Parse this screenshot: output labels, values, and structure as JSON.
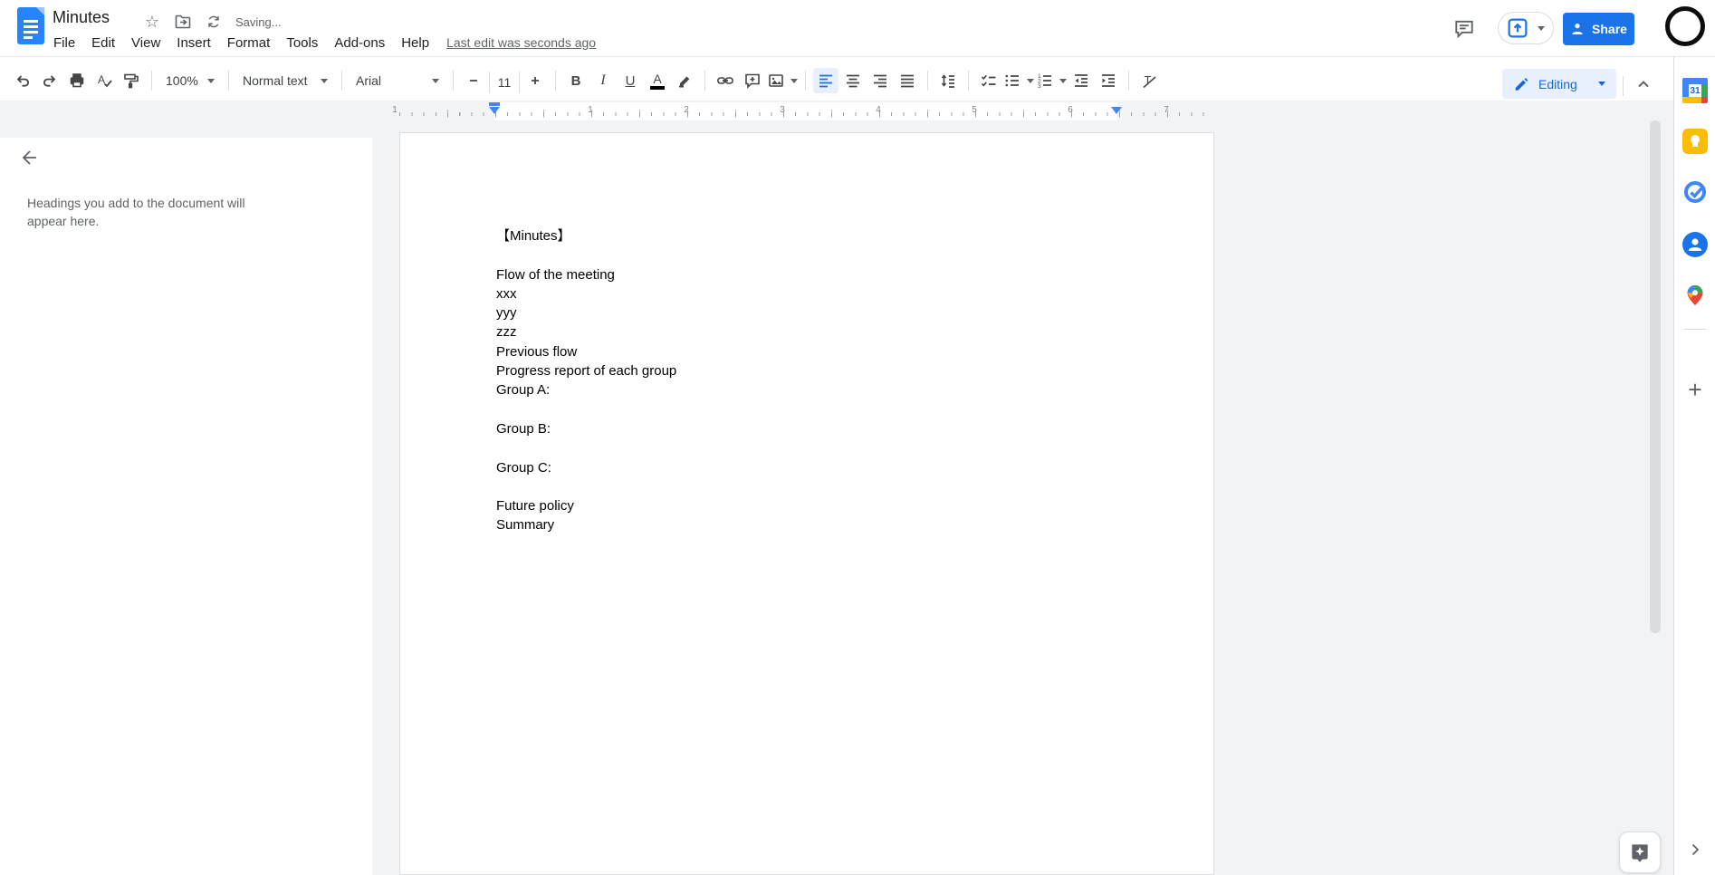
{
  "header": {
    "title": "Minutes",
    "status": "Saving...",
    "menu_items": [
      "File",
      "Edit",
      "View",
      "Insert",
      "Format",
      "Tools",
      "Add-ons",
      "Help"
    ],
    "last_edit": "Last edit was seconds ago",
    "share_label": "Share"
  },
  "toolbar": {
    "zoom_value": "100%",
    "paragraph_style": "Normal text",
    "font_family": "Arial",
    "font_size": "11",
    "bold_label": "B",
    "italic_label": "I",
    "underline_label": "U",
    "text_color_label": "A",
    "mode_label": "Editing"
  },
  "ruler": {
    "margin_label": "1",
    "inch_labels": [
      "1",
      "2",
      "3",
      "4",
      "5",
      "6",
      "7"
    ]
  },
  "outline_panel": {
    "placeholder": "Headings you add to the document will appear here."
  },
  "document": {
    "lines": [
      "【Minutes】",
      "",
      "Flow of the meeting",
      "xxx",
      "yyy",
      "zzz",
      "Previous flow",
      "Progress report of each group",
      "Group A:",
      "",
      "Group B:",
      "",
      "Group C:",
      "",
      "Future policy",
      "Summary"
    ]
  },
  "side_panel": {
    "calendar_label": "31",
    "add_label": "+"
  },
  "colors": {
    "accent_blue": "#1a73e8",
    "docs_logo_blue": "#2684fc",
    "editing_pill_bg": "#e8f0fe",
    "editing_pill_text": "#1967d2",
    "canvas_gray": "#f1f3f4",
    "icon_gray": "#5f6368",
    "keep_yellow": "#fbbc04",
    "tasks_blue": "#4285f4",
    "maps_green": "#34a853",
    "calendar_red": "#ea4335",
    "indent_marker_blue": "#4285f4"
  }
}
